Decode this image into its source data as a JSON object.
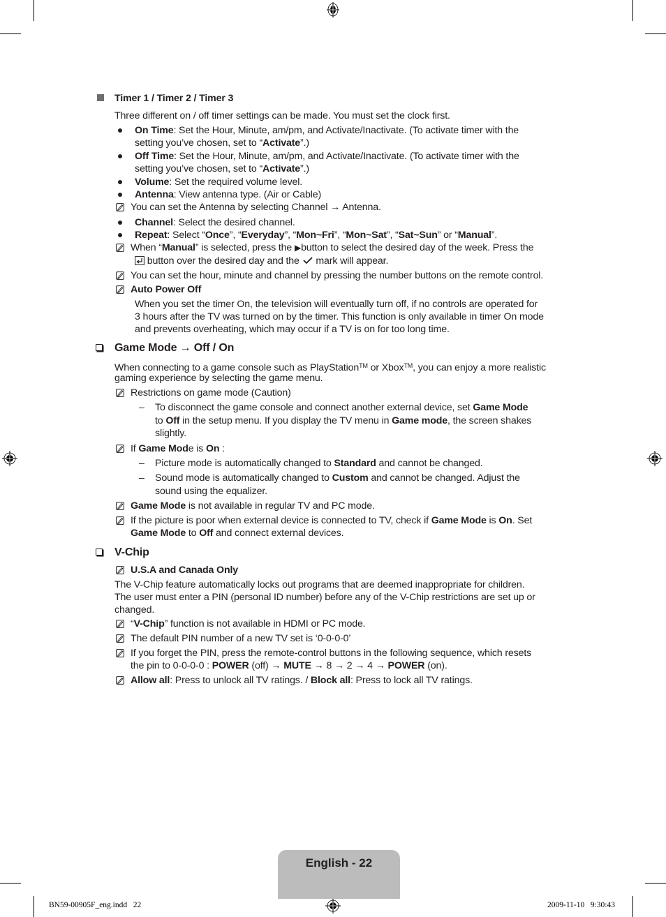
{
  "timer": {
    "heading": "Timer 1 / Timer 2 / Timer 3",
    "intro": "Three different on / off timer settings can be made. You must set the clock first.",
    "on_time_label": "On Time",
    "on_time_text": ": Set the Hour, Minute, am/pm, and Activate/Inactivate. (To activate timer with the",
    "on_time_text2a": "setting you’ve chosen, set to “",
    "activate": "Activate",
    "on_time_text2b": "”.)",
    "off_time_label": "Off Time",
    "off_time_text": ": Set the Hour, Minute, am/pm, and Activate/Inactivate. (To activate timer with the",
    "volume_label": "Volume",
    "volume_text": ": Set the required volume level.",
    "antenna_label": "Antenna",
    "antenna_text": ": View antenna type. (Air or Cable)",
    "antenna_note": "You can set the Antenna by selecting Channel → Antenna.",
    "channel_label": "Channel",
    "channel_text": ": Select the desired channel.",
    "repeat_label": "Repeat",
    "repeat_prefix": ": Select “",
    "repeat_options": [
      "Once",
      "Everyday",
      "Mon~Fri",
      "Mon~Sat",
      "Sat~Sun",
      "Manual"
    ],
    "manual_note_a": "When “",
    "manual_note_b": "” is selected, press the ",
    "manual_note_c": "button to select the desired day of the week. Press the",
    "manual_note_d": " button over the desired day and the ",
    "manual_note_e": " mark will appear.",
    "number_note": "You can set the hour, minute and channel by pressing the number buttons on the remote control.",
    "auto_power_heading": "Auto Power Off",
    "auto_power_lines": [
      "When you set the timer On, the television will eventually turn off, if no controls are operated for",
      "3 hours after the TV was turned on by the timer. This function is only available in timer On mode",
      "and prevents overheating, which may occur if a TV is on for too long time."
    ]
  },
  "game": {
    "heading": "Game Mode → Off / On",
    "intro_a": "When connecting to a game console such as PlayStation",
    "tm": "TM",
    "intro_b": " or Xbox",
    "intro_c": ", you can enjoy a more realistic",
    "intro_line2": "gaming experience by selecting the game menu.",
    "restrictions": "Restrictions on game mode (Caution)",
    "r1_a": "To disconnect the game console and connect another external device, set ",
    "game_mode": "Game Mode",
    "r1_b": "to ",
    "off": "Off",
    "r1_c": " in the setup menu. If you display the TV menu in ",
    "game_mode_lc": "Game mode",
    "r1_d": ", the screen shakes",
    "r1_e": "slightly.",
    "if_a": "If ",
    "if_bold": "Game Mod",
    "if_b": "e is ",
    "on": "On",
    "if_c": " :",
    "p1_a": "Picture mode is automatically changed to ",
    "standard": "Standard",
    "p1_b": " and cannot be changed.",
    "p2_a": "Sound mode is automatically changed to ",
    "custom": "Custom",
    "p2_b": " and cannot be changed. Adjust the",
    "p2_c": "sound using the equalizer.",
    "na_b": " is not available in regular TV and PC mode.",
    "poor_a": "If the picture is poor when external device is connected to TV, check if ",
    "poor_b": " is ",
    "poor_c": ". Set",
    "poor_d": " to ",
    "poor_e": " and connect external devices."
  },
  "vchip": {
    "heading": "V-Chip",
    "region": "U.S.A and Canada Only",
    "desc": [
      "The V-Chip feature automatically locks out programs that are deemed inappropriate for children.",
      "The user must enter a PIN (personal ID number) before any of the V-Chip restrictions are set up or",
      "changed."
    ],
    "hdmi_a": "“",
    "hdmi_bold": "V-Chip",
    "hdmi_b": "” function is not available in HDMI or PC mode.",
    "pin_default": "The default PIN number of a new TV set is ‘0-0-0-0’",
    "forget_1": "If you forget the PIN, press the remote-control buttons in the following sequence, which resets",
    "forget_2a": "the pin to 0-0-0-0 : ",
    "power": "POWER",
    "forget_2b": " (off) → ",
    "mute": "MUTE",
    "forget_2c": " → 8 → 2 → 4 → ",
    "forget_2d": " (on).",
    "allow_all": "Allow all",
    "allow_text": ": Press to unlock all TV ratings. / ",
    "block_all": "Block all",
    "block_text": ": Press to lock all TV ratings."
  },
  "footer": {
    "page_label": "English - 22",
    "slug_file": "BN59-00905F_eng.indd   22",
    "slug_date": "2009-11-10   9:30:43"
  }
}
